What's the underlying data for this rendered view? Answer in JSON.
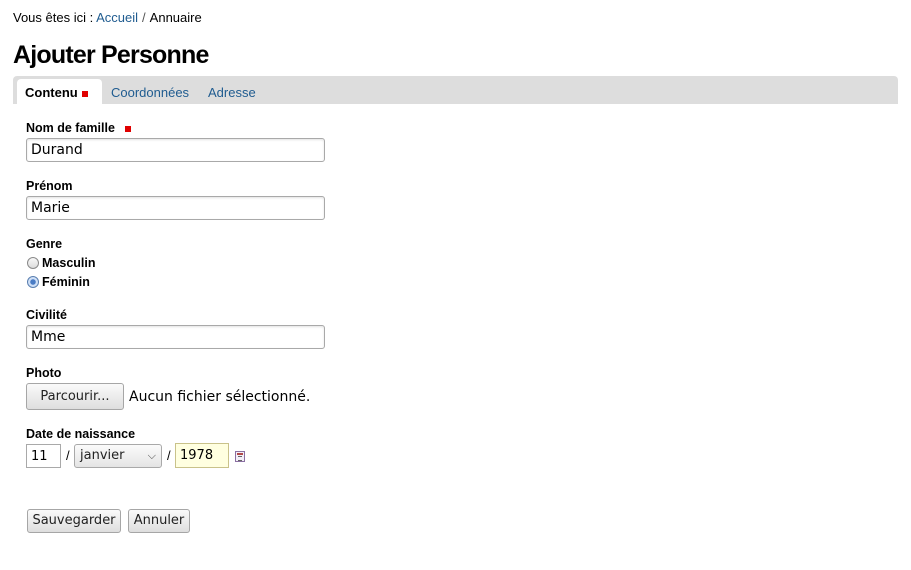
{
  "breadcrumb": {
    "prefix": "Vous êtes ici :",
    "home": "Accueil",
    "separator": "/",
    "current": "Annuaire"
  },
  "page_title": "Ajouter Personne",
  "tabs": [
    {
      "label": "Contenu",
      "active": true,
      "required": true
    },
    {
      "label": "Coordonnées",
      "active": false
    },
    {
      "label": "Adresse",
      "active": false
    }
  ],
  "form": {
    "nom": {
      "label": "Nom de famille",
      "value": "Durand",
      "required": true
    },
    "prenom": {
      "label": "Prénom",
      "value": "Marie"
    },
    "genre": {
      "label": "Genre",
      "options": [
        {
          "label": "Masculin",
          "checked": false
        },
        {
          "label": "Féminin",
          "checked": true
        }
      ]
    },
    "civilite": {
      "label": "Civilité",
      "value": "Mme"
    },
    "photo": {
      "label": "Photo",
      "button": "Parcourir...",
      "status": "Aucun fichier sélectionné."
    },
    "date": {
      "label": "Date de naissance",
      "day": "11",
      "month": "janvier",
      "year": "1978",
      "separator": "/",
      "calendar_icon": "calendar-icon"
    }
  },
  "actions": {
    "save": "Sauvegarder",
    "cancel": "Annuler"
  },
  "colors": {
    "link": "#205c90",
    "required": "#e00000",
    "tabbar": "#dddddd",
    "year_bg": "#ffffe0"
  }
}
